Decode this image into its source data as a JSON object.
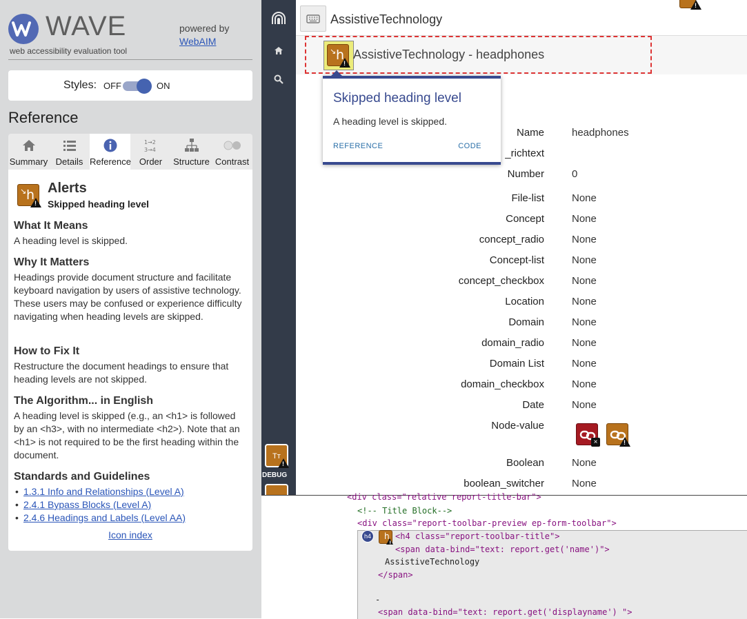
{
  "wave": {
    "logo_text": "WAVE",
    "tagline": "web accessibility evaluation tool",
    "powered_by": "powered by",
    "webaim_link": "WebAIM",
    "styles_label": "Styles:",
    "styles_off": "OFF",
    "styles_on": "ON",
    "reference_heading": "Reference",
    "tabs": [
      {
        "label": "Summary",
        "icon": "home-icon"
      },
      {
        "label": "Details",
        "icon": "list-icon"
      },
      {
        "label": "Reference",
        "icon": "info-icon",
        "active": true
      },
      {
        "label": "Order",
        "icon": "order-icon"
      },
      {
        "label": "Structure",
        "icon": "structure-icon"
      },
      {
        "label": "Contrast",
        "icon": "contrast-icon"
      }
    ],
    "alert": {
      "category": "Alerts",
      "name": "Skipped heading level",
      "what_heading": "What It Means",
      "what_text": "A heading level is skipped.",
      "why_heading": "Why It Matters",
      "why_text": "Headings provide document structure and facilitate keyboard navigation by users of assistive technology. These users may be confused or experience difficulty navigating when heading levels are skipped.",
      "fix_heading": "How to Fix It",
      "fix_text": "Restructure the document headings to ensure that heading levels are not skipped.",
      "algo_heading": "The Algorithm... in English",
      "algo_text": "A heading level is skipped (e.g., an <h1> is followed by an <h3>, with no intermediate <h2>). Note that an <h1> is not required to be the first heading within the document.",
      "standards_heading": "Standards and Guidelines",
      "standards": [
        "1.3.1 Info and Relationships (Level A)",
        "2.4.1 Bypass Blocks (Level A)",
        "2.4.6 Headings and Labels (Level AA)"
      ],
      "icon_index": "Icon index"
    }
  },
  "sidebar": {
    "debug_label": "DEBUG",
    "tt_badge": "Tт"
  },
  "main": {
    "title": "AssistiveTechnology",
    "subtitle": "AssistiveTechnology - headphones",
    "tooltip": {
      "title": "Skipped heading level",
      "desc": "A heading level is skipped.",
      "reference": "REFERENCE",
      "code": "CODE"
    },
    "fields": [
      {
        "key": "Name",
        "value": "headphones"
      },
      {
        "key": "_richtext",
        "value": ""
      },
      {
        "key": "Number",
        "value": "0"
      },
      {
        "key": "File-list",
        "value": "None"
      },
      {
        "key": "Concept",
        "value": "None"
      },
      {
        "key": "concept_radio",
        "value": "None"
      },
      {
        "key": "Concept-list",
        "value": "None"
      },
      {
        "key": "concept_checkbox",
        "value": "None"
      },
      {
        "key": "Location",
        "value": "None"
      },
      {
        "key": "Domain",
        "value": "None"
      },
      {
        "key": "domain_radio",
        "value": "None"
      },
      {
        "key": "Domain List",
        "value": "None"
      },
      {
        "key": "domain_checkbox",
        "value": "None"
      },
      {
        "key": "Date",
        "value": "None"
      },
      {
        "key": "Node-value",
        "value": ""
      },
      {
        "key": "Boolean",
        "value": "None"
      },
      {
        "key": "boolean_switcher",
        "value": "None"
      }
    ]
  },
  "code": {
    "line1": "<div class=\"relative report-title-bar\">",
    "line2": "<!-- Title Block-->",
    "line3": "<div class=\"report-toolbar-preview ep-form-toolbar\">",
    "line4": "<h4 class=\"report-toolbar-title\">",
    "line5": "<span data-bind=\"text: report.get('name')\">",
    "line6": "AssistiveTechnology",
    "line7": "</span>",
    "line8": "-",
    "line9": "<span data-bind=\"text: report.get('displayname') \">",
    "h4_pill": "h4"
  }
}
